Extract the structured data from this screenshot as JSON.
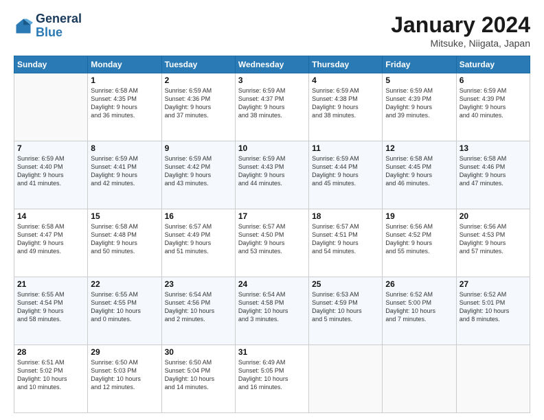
{
  "header": {
    "logo_line1": "General",
    "logo_line2": "Blue",
    "title": "January 2024",
    "subtitle": "Mitsuke, Niigata, Japan"
  },
  "weekdays": [
    "Sunday",
    "Monday",
    "Tuesday",
    "Wednesday",
    "Thursday",
    "Friday",
    "Saturday"
  ],
  "weeks": [
    [
      {
        "day": "",
        "info": ""
      },
      {
        "day": "1",
        "info": "Sunrise: 6:58 AM\nSunset: 4:35 PM\nDaylight: 9 hours\nand 36 minutes."
      },
      {
        "day": "2",
        "info": "Sunrise: 6:59 AM\nSunset: 4:36 PM\nDaylight: 9 hours\nand 37 minutes."
      },
      {
        "day": "3",
        "info": "Sunrise: 6:59 AM\nSunset: 4:37 PM\nDaylight: 9 hours\nand 38 minutes."
      },
      {
        "day": "4",
        "info": "Sunrise: 6:59 AM\nSunset: 4:38 PM\nDaylight: 9 hours\nand 38 minutes."
      },
      {
        "day": "5",
        "info": "Sunrise: 6:59 AM\nSunset: 4:39 PM\nDaylight: 9 hours\nand 39 minutes."
      },
      {
        "day": "6",
        "info": "Sunrise: 6:59 AM\nSunset: 4:39 PM\nDaylight: 9 hours\nand 40 minutes."
      }
    ],
    [
      {
        "day": "7",
        "info": "Sunrise: 6:59 AM\nSunset: 4:40 PM\nDaylight: 9 hours\nand 41 minutes."
      },
      {
        "day": "8",
        "info": "Sunrise: 6:59 AM\nSunset: 4:41 PM\nDaylight: 9 hours\nand 42 minutes."
      },
      {
        "day": "9",
        "info": "Sunrise: 6:59 AM\nSunset: 4:42 PM\nDaylight: 9 hours\nand 43 minutes."
      },
      {
        "day": "10",
        "info": "Sunrise: 6:59 AM\nSunset: 4:43 PM\nDaylight: 9 hours\nand 44 minutes."
      },
      {
        "day": "11",
        "info": "Sunrise: 6:59 AM\nSunset: 4:44 PM\nDaylight: 9 hours\nand 45 minutes."
      },
      {
        "day": "12",
        "info": "Sunrise: 6:58 AM\nSunset: 4:45 PM\nDaylight: 9 hours\nand 46 minutes."
      },
      {
        "day": "13",
        "info": "Sunrise: 6:58 AM\nSunset: 4:46 PM\nDaylight: 9 hours\nand 47 minutes."
      }
    ],
    [
      {
        "day": "14",
        "info": "Sunrise: 6:58 AM\nSunset: 4:47 PM\nDaylight: 9 hours\nand 49 minutes."
      },
      {
        "day": "15",
        "info": "Sunrise: 6:58 AM\nSunset: 4:48 PM\nDaylight: 9 hours\nand 50 minutes."
      },
      {
        "day": "16",
        "info": "Sunrise: 6:57 AM\nSunset: 4:49 PM\nDaylight: 9 hours\nand 51 minutes."
      },
      {
        "day": "17",
        "info": "Sunrise: 6:57 AM\nSunset: 4:50 PM\nDaylight: 9 hours\nand 53 minutes."
      },
      {
        "day": "18",
        "info": "Sunrise: 6:57 AM\nSunset: 4:51 PM\nDaylight: 9 hours\nand 54 minutes."
      },
      {
        "day": "19",
        "info": "Sunrise: 6:56 AM\nSunset: 4:52 PM\nDaylight: 9 hours\nand 55 minutes."
      },
      {
        "day": "20",
        "info": "Sunrise: 6:56 AM\nSunset: 4:53 PM\nDaylight: 9 hours\nand 57 minutes."
      }
    ],
    [
      {
        "day": "21",
        "info": "Sunrise: 6:55 AM\nSunset: 4:54 PM\nDaylight: 9 hours\nand 58 minutes."
      },
      {
        "day": "22",
        "info": "Sunrise: 6:55 AM\nSunset: 4:55 PM\nDaylight: 10 hours\nand 0 minutes."
      },
      {
        "day": "23",
        "info": "Sunrise: 6:54 AM\nSunset: 4:56 PM\nDaylight: 10 hours\nand 2 minutes."
      },
      {
        "day": "24",
        "info": "Sunrise: 6:54 AM\nSunset: 4:58 PM\nDaylight: 10 hours\nand 3 minutes."
      },
      {
        "day": "25",
        "info": "Sunrise: 6:53 AM\nSunset: 4:59 PM\nDaylight: 10 hours\nand 5 minutes."
      },
      {
        "day": "26",
        "info": "Sunrise: 6:52 AM\nSunset: 5:00 PM\nDaylight: 10 hours\nand 7 minutes."
      },
      {
        "day": "27",
        "info": "Sunrise: 6:52 AM\nSunset: 5:01 PM\nDaylight: 10 hours\nand 8 minutes."
      }
    ],
    [
      {
        "day": "28",
        "info": "Sunrise: 6:51 AM\nSunset: 5:02 PM\nDaylight: 10 hours\nand 10 minutes."
      },
      {
        "day": "29",
        "info": "Sunrise: 6:50 AM\nSunset: 5:03 PM\nDaylight: 10 hours\nand 12 minutes."
      },
      {
        "day": "30",
        "info": "Sunrise: 6:50 AM\nSunset: 5:04 PM\nDaylight: 10 hours\nand 14 minutes."
      },
      {
        "day": "31",
        "info": "Sunrise: 6:49 AM\nSunset: 5:05 PM\nDaylight: 10 hours\nand 16 minutes."
      },
      {
        "day": "",
        "info": ""
      },
      {
        "day": "",
        "info": ""
      },
      {
        "day": "",
        "info": ""
      }
    ]
  ]
}
